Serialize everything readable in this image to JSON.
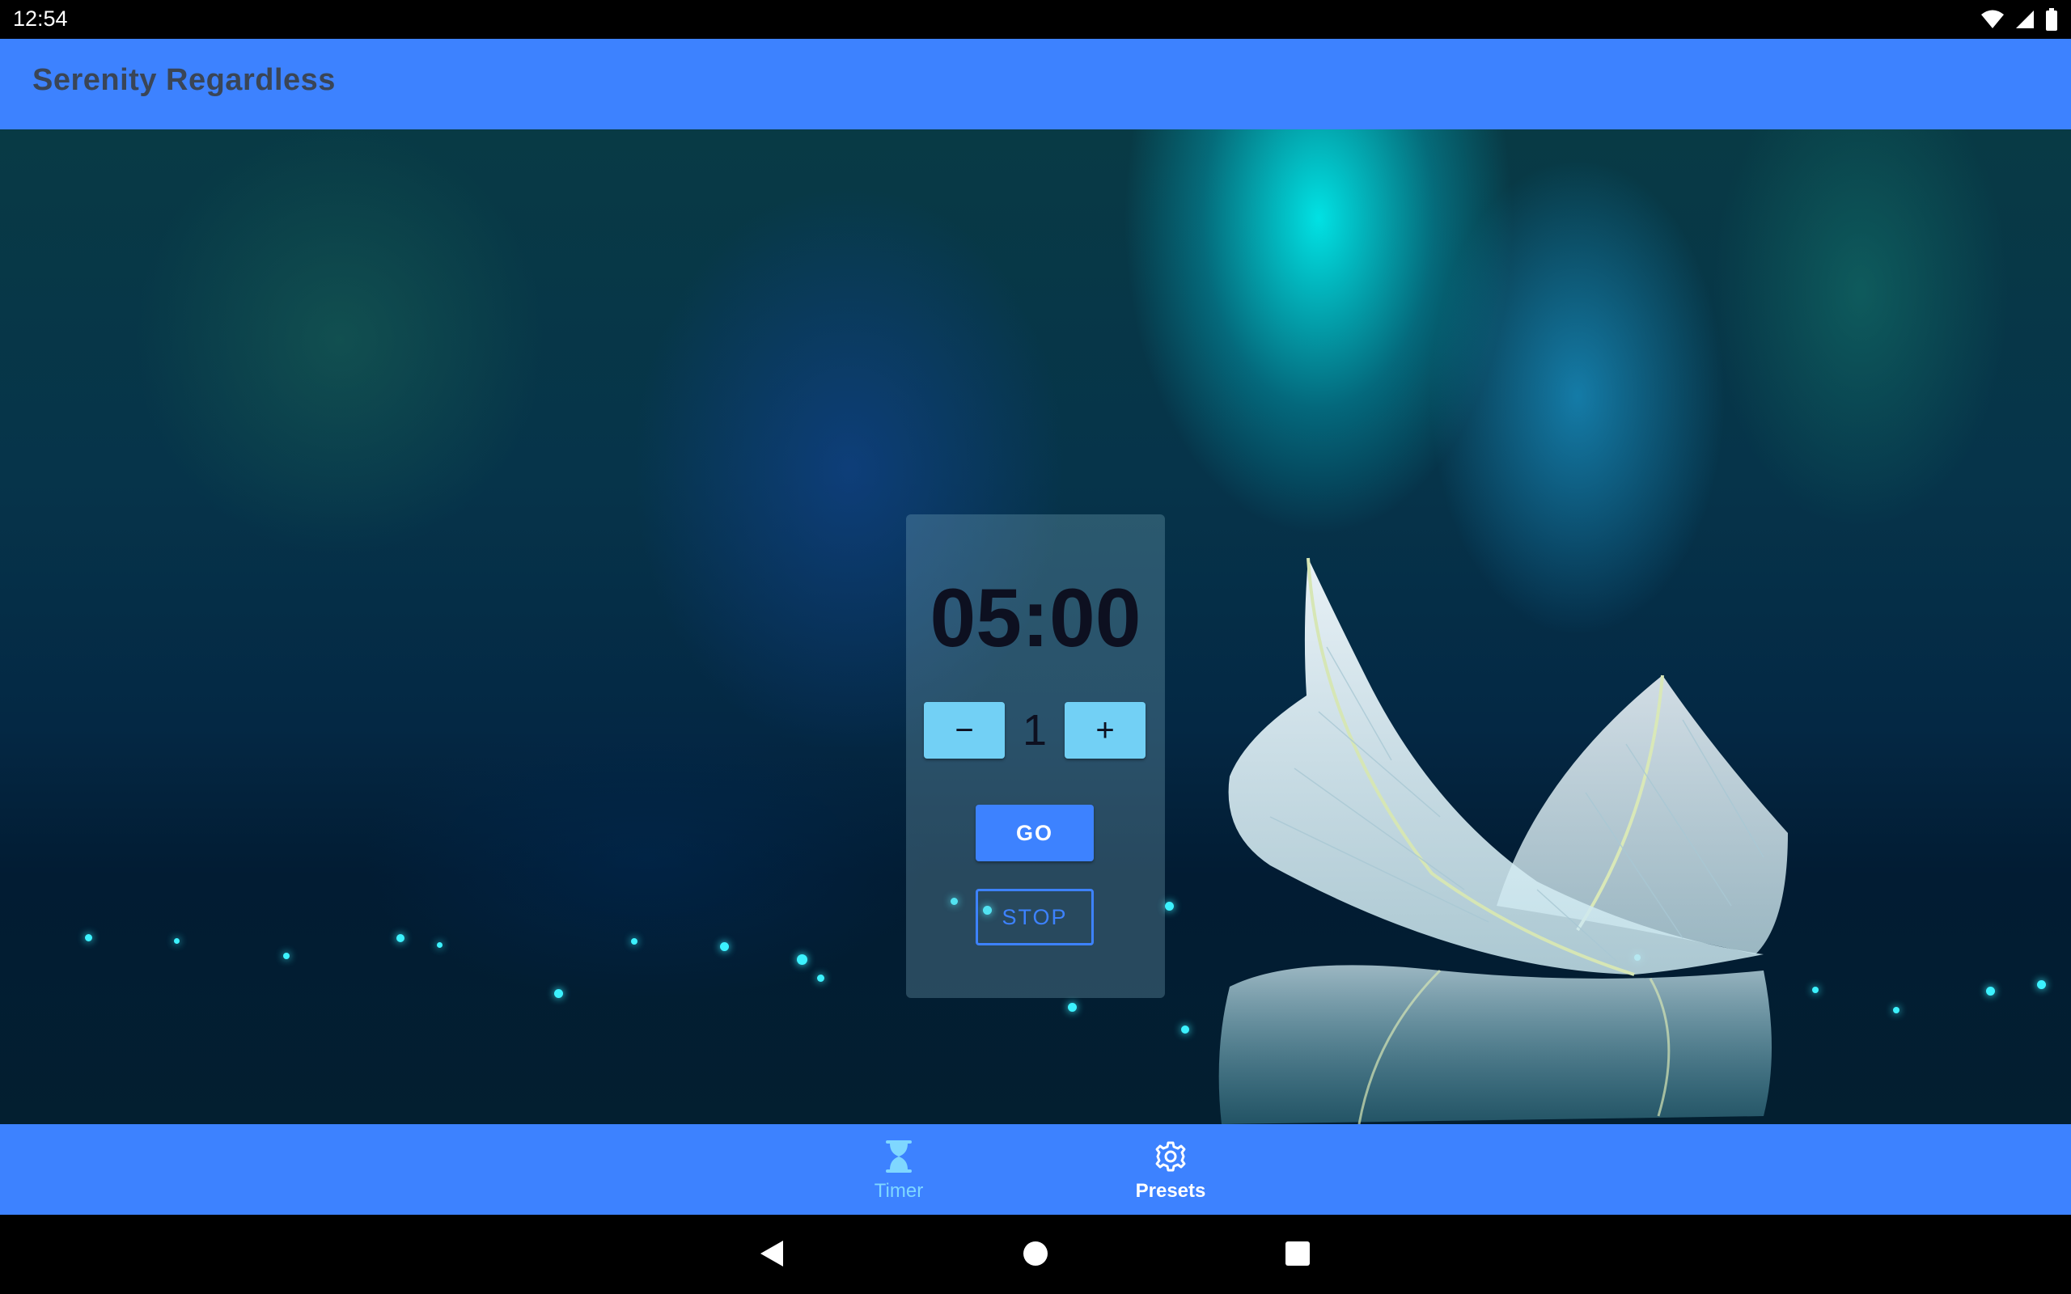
{
  "status_bar": {
    "time": "12:54",
    "icons": [
      "wifi-icon",
      "signal-icon",
      "battery-icon"
    ]
  },
  "app_bar": {
    "title": "Serenity Regardless"
  },
  "timer": {
    "display": "05:00",
    "decrement_symbol": "−",
    "increment_symbol": "+",
    "step_value": "1",
    "go_label": "GO",
    "stop_label": "STOP"
  },
  "bottom_nav": {
    "items": [
      {
        "label": "Timer",
        "icon": "hourglass-icon",
        "selected": false
      },
      {
        "label": "Presets",
        "icon": "gear-icon",
        "selected": true
      }
    ]
  },
  "system_nav": {
    "buttons": [
      "back-icon",
      "home-icon",
      "recents-icon"
    ]
  },
  "colors": {
    "primary": "#3d82ff",
    "stepper": "#72d0f5",
    "status_bar": "#000000"
  }
}
